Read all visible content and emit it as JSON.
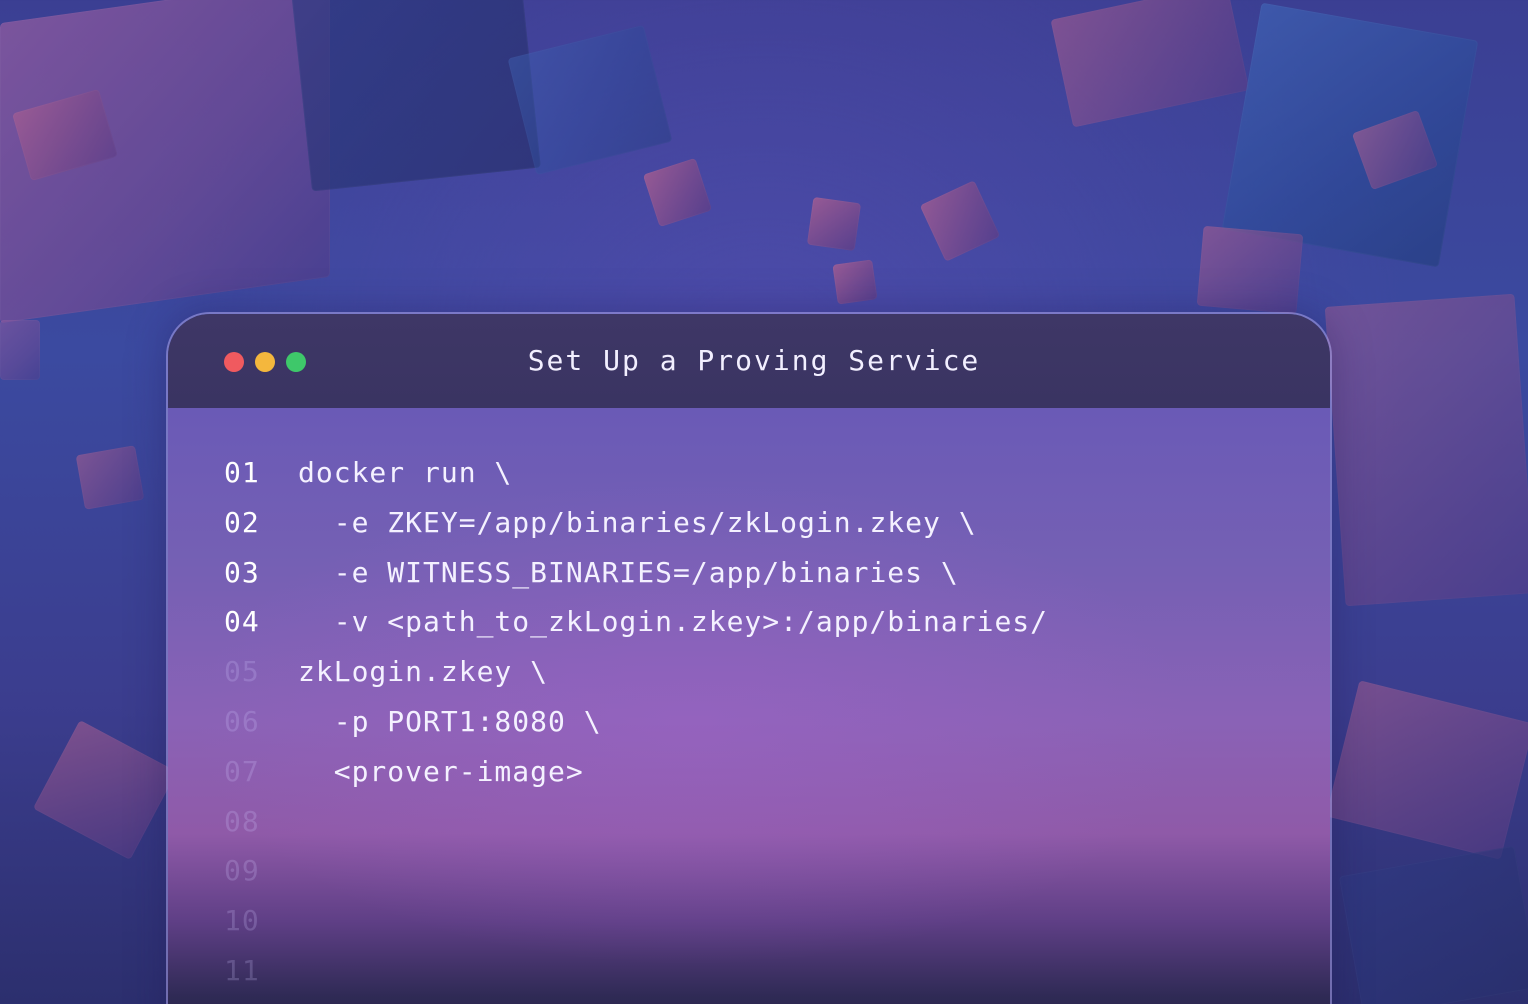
{
  "window": {
    "title": "Set Up a Proving Service",
    "controls": {
      "close_color": "#f05a5f",
      "minimize_color": "#f4b73d",
      "maximize_color": "#3ec86a"
    }
  },
  "code": {
    "lines": [
      {
        "num": "01",
        "text": "docker run \\",
        "active": true
      },
      {
        "num": "02",
        "text": "  -e ZKEY=/app/binaries/zkLogin.zkey \\",
        "active": true
      },
      {
        "num": "03",
        "text": "  -e WITNESS_BINARIES=/app/binaries \\",
        "active": true
      },
      {
        "num": "04",
        "text": "  -v <path_to_zkLogin.zkey>:/app/binaries/",
        "active": true
      },
      {
        "num": "05",
        "text": "zkLogin.zkey \\",
        "active": false
      },
      {
        "num": "06",
        "text": "  -p PORT1:8080 \\",
        "active": false
      },
      {
        "num": "07",
        "text": "  <prover-image>",
        "active": false
      },
      {
        "num": "08",
        "text": "",
        "active": false
      },
      {
        "num": "09",
        "text": "",
        "active": false
      },
      {
        "num": "10",
        "text": "",
        "active": false
      },
      {
        "num": "11",
        "text": "",
        "active": false
      }
    ]
  }
}
